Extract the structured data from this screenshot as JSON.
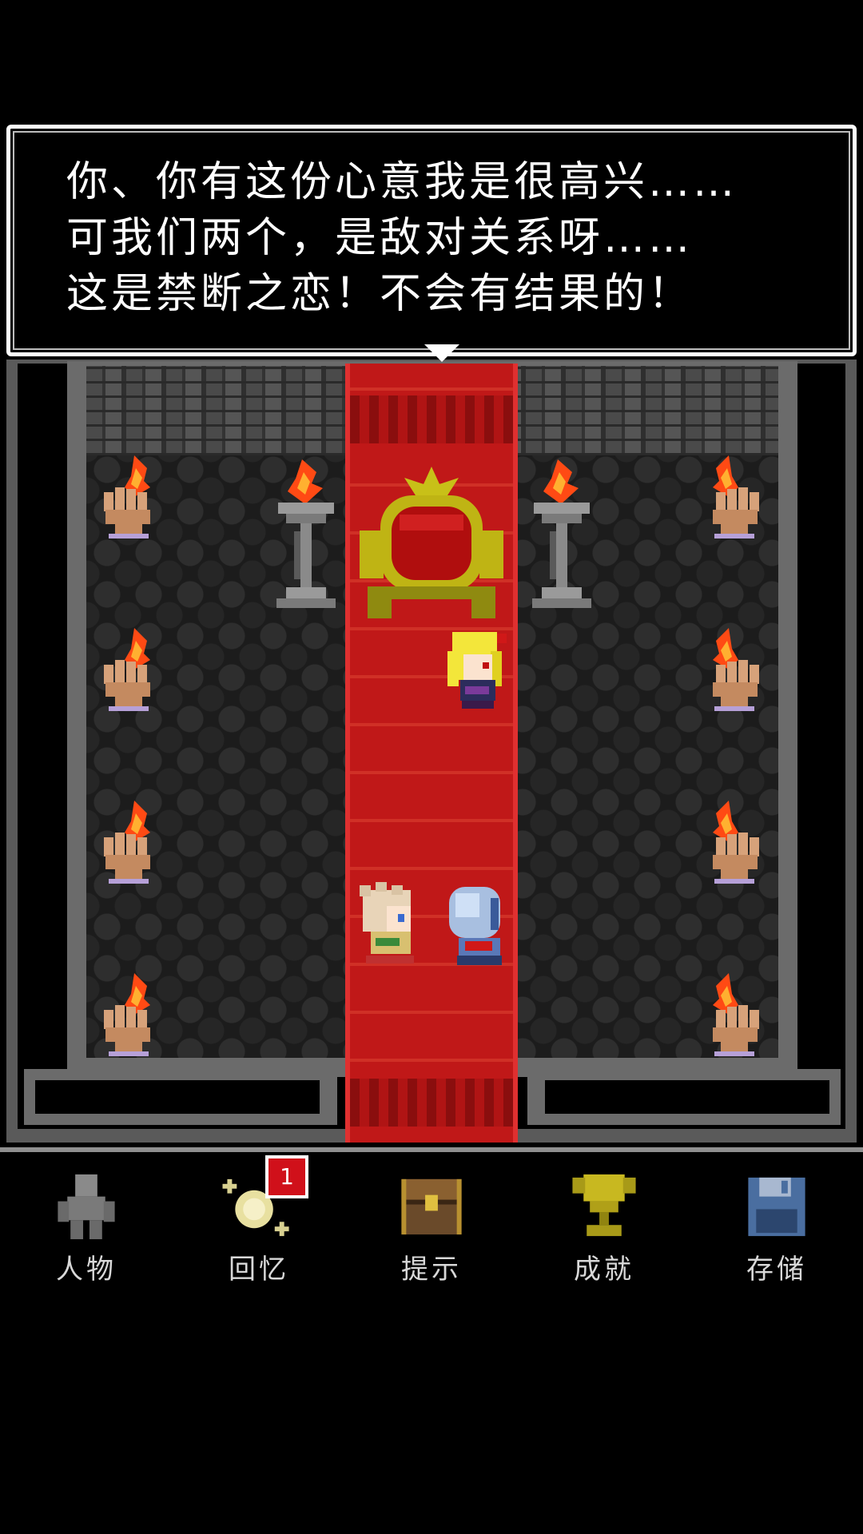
{
  "dialog": {
    "lines": [
      "你、你有这份心意我是很高兴……",
      "可我们两个，是敌对关系呀……",
      "这是禁断之恋！不会有结果的！"
    ],
    "continue_icon": "down-triangle-icon"
  },
  "scene": {
    "location": "throne-room",
    "carpet_color": "#c01818",
    "floor_color": "#1c1c1c",
    "wall_color": "#6b6b6b"
  },
  "nav": {
    "items": [
      {
        "label": "人物",
        "icon": "person-icon"
      },
      {
        "label": "回忆",
        "icon": "sparkle-icon",
        "badge": "1"
      },
      {
        "label": "提示",
        "icon": "chest-icon"
      },
      {
        "label": "成就",
        "icon": "trophy-icon"
      },
      {
        "label": "存储",
        "icon": "floppy-disk-icon"
      }
    ]
  },
  "colors": {
    "badge": "#d0101a",
    "nav_label": "#d8d8d8",
    "trophy": "#c8b820",
    "floppy": "#4a6ea0"
  }
}
